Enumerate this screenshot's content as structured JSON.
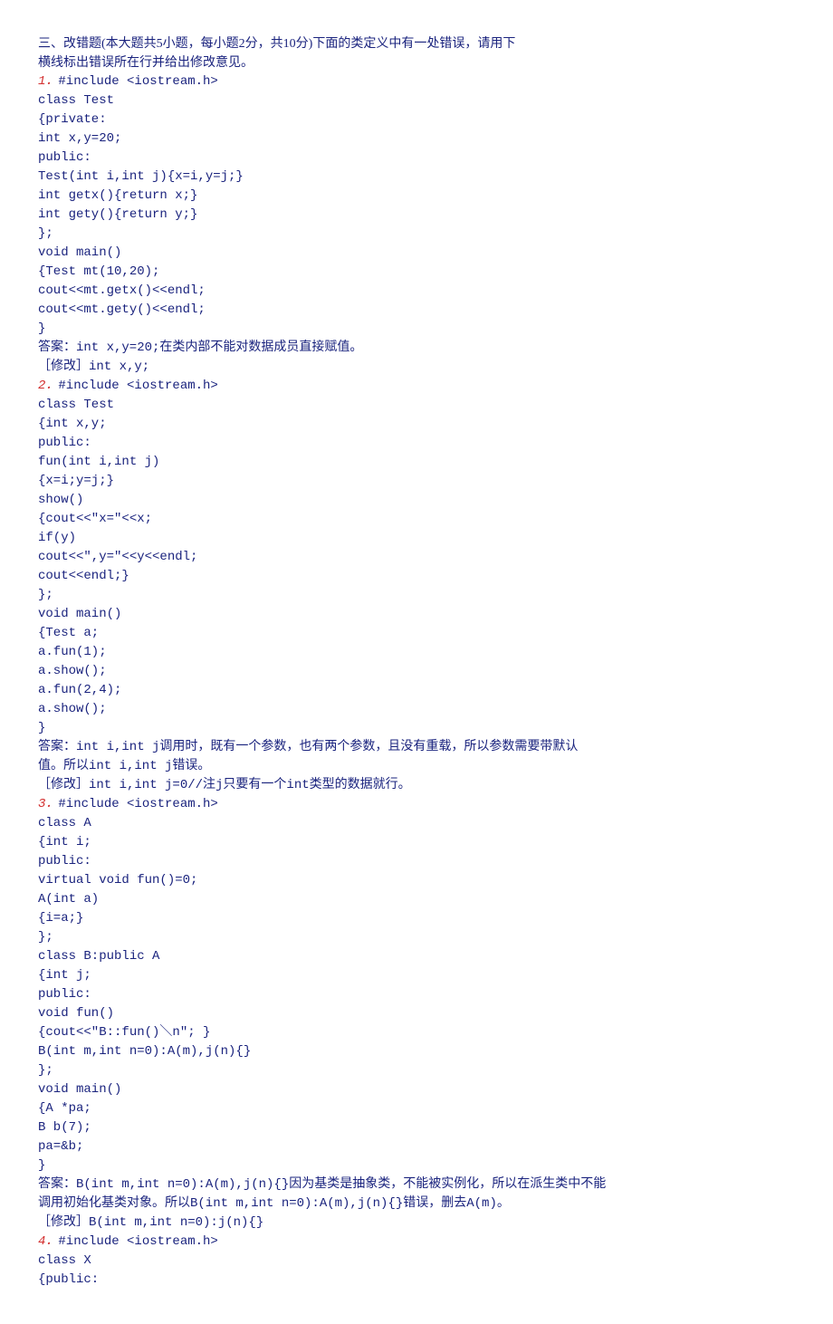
{
  "header": {
    "line1": "三、改错题(本大题共5小题，每小题2分，共10分)下面的类定义中有一处错误，请用下",
    "line2": "横线标出错误所在行并给出修改意见。"
  },
  "q1": {
    "num": "1．",
    "include": "#include <iostream.h>",
    "code": [
      "class Test",
      "{private:",
      "int x,y=20;",
      "public:",
      "Test(int i,int j){x=i,y=j;}",
      "int getx(){return x;}",
      "int gety(){return y;}",
      "};",
      "void main()",
      "{Test mt(10,20);",
      "cout<<mt.getx()<<endl;",
      "cout<<mt.gety()<<endl;",
      "}"
    ],
    "answer": "答案：int x,y=20;在类内部不能对数据成员直接赋值。",
    "fix": "［修改］int x,y;"
  },
  "q2": {
    "num": "2．",
    "include": "#include <iostream.h>",
    "code": [
      "class Test",
      "{int x,y;",
      "public:",
      "fun(int i,int j)",
      "{x=i;y=j;}",
      "show()",
      "{cout<<\"x=\"<<x;",
      "if(y)",
      "cout<<\",y=\"<<y<<endl;",
      "cout<<endl;}",
      "};",
      "void main()",
      "{Test a;",
      "a.fun(1);",
      "a.show();",
      "a.fun(2,4);",
      "a.show();",
      "}"
    ],
    "answer1": "答案：int i,int j调用时，既有一个参数，也有两个参数，且没有重载，所以参数需要带默认",
    "answer2": "值。所以int i,int j错误。",
    "fix": "［修改］int i,int j=0//注j只要有一个int类型的数据就行。"
  },
  "q3": {
    "num": "3．",
    "include": "#include <iostream.h>",
    "code": [
      "class A",
      "{int i;",
      "public:",
      "virtual void fun()=0;",
      "A(int a)",
      "{i=a;}",
      "};",
      "class B:public A",
      "{int j;",
      "public:",
      "void fun()",
      "{cout<<\"B::fun()＼n\"; }",
      "B(int m,int n=0):A(m),j(n){}",
      "};",
      "void main()",
      "{A *pa;",
      "B b(7);",
      "pa=&b;",
      "}"
    ],
    "answer1": "答案：B(int m,int n=0):A(m),j(n){}因为基类是抽象类，不能被实例化，所以在派生类中不能",
    "answer2": "调用初始化基类对象。所以B(int m,int n=0):A(m),j(n){}错误，删去A(m)。",
    "fix": "［修改］B(int m,int n=0):j(n){}"
  },
  "q4": {
    "num": "4．",
    "include": "#include <iostream.h>",
    "code": [
      "class X",
      "{public:"
    ]
  }
}
